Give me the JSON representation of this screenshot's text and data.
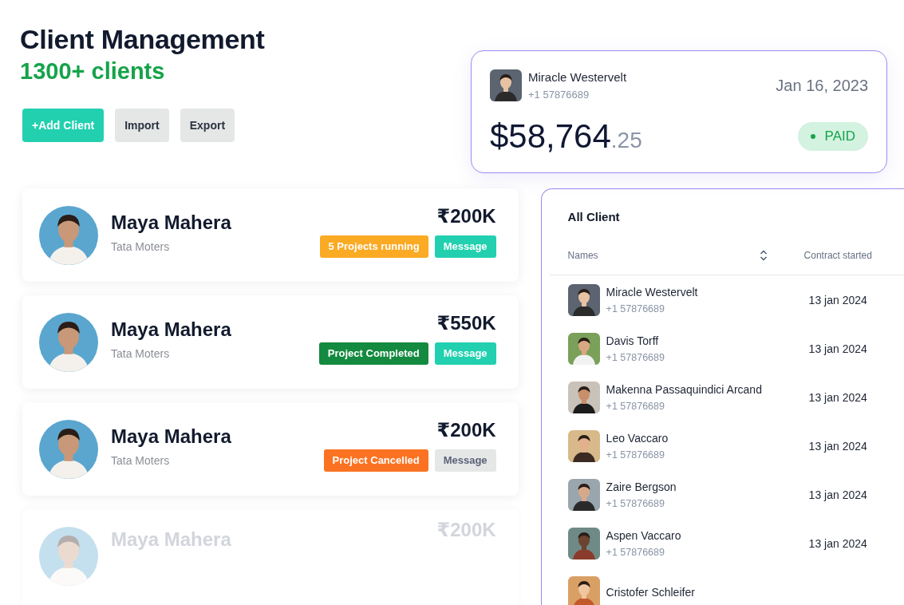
{
  "header": {
    "title": "Client Management",
    "subtitle": "1300+ clients",
    "buttons": [
      {
        "label": "+Add Client",
        "kind": "primary"
      },
      {
        "label": "Import",
        "kind": "secondary"
      },
      {
        "label": "Export",
        "kind": "secondary"
      }
    ]
  },
  "invoice": {
    "name": "Miracle Westervelt",
    "phone": "+1 57876689",
    "date": "Jan 16, 2023",
    "amount": "$58,764",
    "cents": ".25",
    "status": "PAID"
  },
  "client_cards": [
    {
      "name": "Maya Mahera",
      "company": "Tata Moters",
      "amount": "₹200K",
      "status": {
        "label": "5 Projects running",
        "kind": "running"
      },
      "message": {
        "label": "Message",
        "disabled": false
      },
      "faded": false
    },
    {
      "name": "Maya Mahera",
      "company": "Tata Moters",
      "amount": "₹550K",
      "status": {
        "label": "Project Completed",
        "kind": "completed"
      },
      "message": {
        "label": "Message",
        "disabled": false
      },
      "faded": false
    },
    {
      "name": "Maya Mahera",
      "company": "Tata Moters",
      "amount": "₹200K",
      "status": {
        "label": "Project Cancelled",
        "kind": "cancelled"
      },
      "message": {
        "label": "Message",
        "disabled": true
      },
      "faded": false
    },
    {
      "name": "Maya Mahera",
      "amount": "₹200K",
      "faded": true
    }
  ],
  "table": {
    "title": "All Client",
    "columns": [
      "Names",
      "Contract started"
    ],
    "rows": [
      {
        "name": "Miracle Westervelt",
        "phone": "+1 57876689",
        "date": "13 jan 2024"
      },
      {
        "name": "Davis Torff",
        "phone": "+1 57876689",
        "date": "13 jan 2024"
      },
      {
        "name": "Makenna Passaquindici Arcand",
        "phone": "+1 57876689",
        "date": "13 jan 2024"
      },
      {
        "name": "Leo Vaccaro",
        "phone": "+1 57876689",
        "date": "13 jan 2024"
      },
      {
        "name": "Zaire Bergson",
        "phone": "+1 57876689",
        "date": "13 jan 2024"
      },
      {
        "name": "Aspen Vaccaro",
        "phone": "+1 57876689",
        "date": "13 jan 2024"
      },
      {
        "name": "Cristofer Schleifer"
      }
    ]
  }
}
